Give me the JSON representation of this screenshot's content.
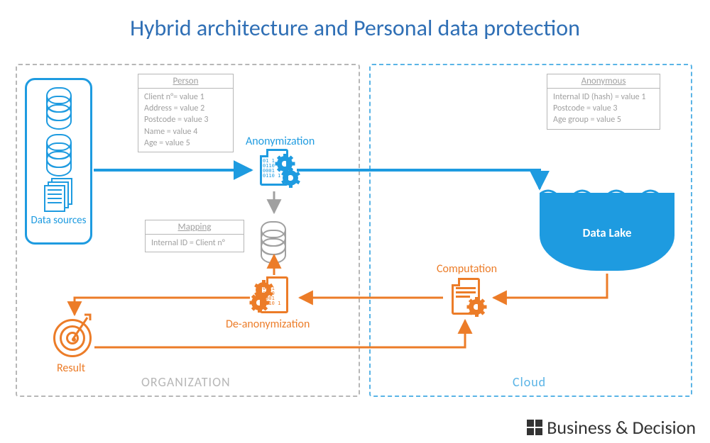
{
  "title": "Hybrid architecture and Personal data protection",
  "regions": {
    "organization": "ORGANIZATION",
    "cloud": "Cloud"
  },
  "data_sources_label": "Data sources",
  "tables": {
    "person": {
      "title": "Person",
      "rows": [
        "Client n°= value 1",
        "Address = value 2",
        "Postcode = value 3",
        "Name = value 4",
        "Age = value 5"
      ]
    },
    "mapping": {
      "title": "Mapping",
      "rows": [
        "Internal ID = Client n°"
      ]
    },
    "anonymous": {
      "title": "Anonymous",
      "rows": [
        "Internal ID (hash) = value 1",
        "Postcode = value 3",
        "Age group = value 5"
      ]
    }
  },
  "steps": {
    "anonymization": "Anonymization",
    "deanonymization": "De-anonymization",
    "computation": "Computation",
    "datalake": "Data Lake",
    "result": "Result"
  },
  "footer": {
    "brand": "Business & Decision"
  },
  "colors": {
    "blue": "#1e9be0",
    "orange": "#ec7c28",
    "gray": "#a0a0a0",
    "lightblue_dash": "#5ab4e6"
  }
}
